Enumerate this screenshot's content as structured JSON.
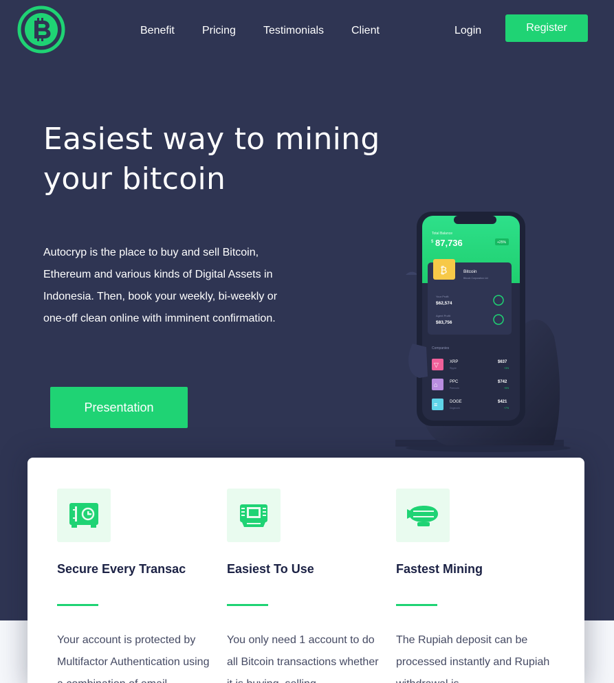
{
  "colors": {
    "hero_background": "#2f3553",
    "accent_green": "#1fd374",
    "card_background": "#ffffff",
    "icon_box_background": "#e9fbef",
    "heading_dark": "#1b2144",
    "body_text": "#454a63"
  },
  "logo": {
    "icon": "bitcoin-icon"
  },
  "nav": {
    "links": [
      "Benefit",
      "Pricing",
      "Testimonials",
      "Client"
    ],
    "login_label": "Login",
    "register_label": "Register"
  },
  "hero": {
    "title_line1": "Easiest way to mining",
    "title_line2": "your bitcoin",
    "description": "Autocryp is the place to buy and sell Bitcoin, Ethereum and various kinds of Digital Assets in Indonesia. Then, book your weekly, bi-weekly or one-off clean online with imminent confirmation.",
    "cta_label": "Presentation"
  },
  "phone": {
    "header_label": "Total Balance",
    "balance_currency": "$",
    "balance": "87,736",
    "balance_change": "+25%",
    "featured_coin": "Bitcoin",
    "featured_coin_sub": "Bitcoin Corporation Ltd",
    "your_profit_label": "Your Profit",
    "your_profit": "$62,574",
    "agent_profit_label": "Agent Profit",
    "agent_profit": "$83,756",
    "list_header": "Companies",
    "coins": [
      {
        "name": "XRP",
        "sub": "Ripple",
        "price": "$637",
        "change": "+3%",
        "color": "#f0609a",
        "icon": "cocktail-icon"
      },
      {
        "name": "PPC",
        "sub": "Peercoin",
        "price": "$742",
        "change": "+5%",
        "color": "#b98de0",
        "icon": "bank-icon"
      },
      {
        "name": "DOGE",
        "sub": "Dogecoin",
        "price": "$421",
        "change": "+7%",
        "color": "#5fd4e8",
        "icon": "stack-icon"
      }
    ]
  },
  "features": [
    {
      "icon": "safe-icon",
      "title": "Secure Every Transac",
      "text": "Your account is protected by Multifactor Authentication using a combination of email,"
    },
    {
      "icon": "atm-icon",
      "title": "Easiest To Use",
      "text": "You only need 1 account to do all Bitcoin transactions whether it is buying, selling,"
    },
    {
      "icon": "airship-icon",
      "title": "Fastest Mining",
      "text": "The Rupiah deposit can be processed instantly and Rupiah withdrawal is"
    }
  ]
}
